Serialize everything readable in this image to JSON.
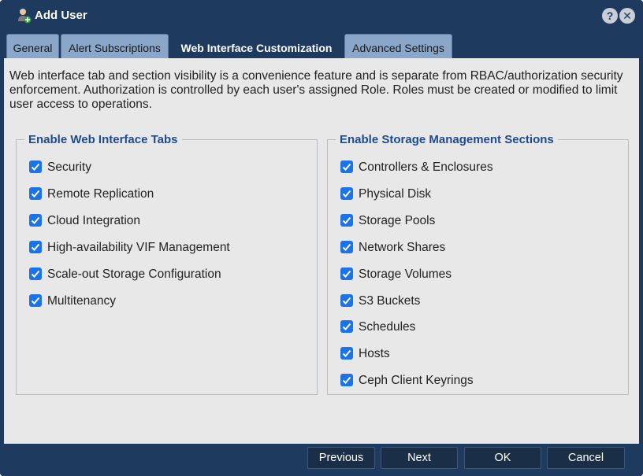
{
  "window": {
    "title": "Add User",
    "title_icon": "add-user-icon",
    "help_glyph": "?",
    "close_glyph": "✕"
  },
  "tabs": [
    {
      "label": "General",
      "active": false
    },
    {
      "label": "Alert Subscriptions",
      "active": false
    },
    {
      "label": "Web Interface Customization",
      "active": true
    },
    {
      "label": "Advanced Settings",
      "active": false
    }
  ],
  "description": "Web interface tab and section visibility is a convenience feature and is separate from RBAC/authorization security enforcement. Authorization is controlled by each user's assigned Role. Roles must be created or modified to limit user access to operations.",
  "web_tabs_group": {
    "title": "Enable Web Interface Tabs",
    "items": [
      {
        "label": "Security",
        "checked": true
      },
      {
        "label": "Remote Replication",
        "checked": true
      },
      {
        "label": "Cloud Integration",
        "checked": true
      },
      {
        "label": "High-availability VIF Management",
        "checked": true
      },
      {
        "label": "Scale-out Storage Configuration",
        "checked": true
      },
      {
        "label": "Multitenancy",
        "checked": true
      }
    ]
  },
  "storage_sections_group": {
    "title": "Enable Storage Management Sections",
    "items": [
      {
        "label": "Controllers & Enclosures",
        "checked": true
      },
      {
        "label": "Physical Disk",
        "checked": true
      },
      {
        "label": "Storage Pools",
        "checked": true
      },
      {
        "label": "Network Shares",
        "checked": true
      },
      {
        "label": "Storage Volumes",
        "checked": true
      },
      {
        "label": "S3 Buckets",
        "checked": true
      },
      {
        "label": "Schedules",
        "checked": true
      },
      {
        "label": "Hosts",
        "checked": true
      },
      {
        "label": "Ceph Client Keyrings",
        "checked": true
      }
    ]
  },
  "footer": {
    "previous_label": "Previous",
    "next_label": "Next",
    "ok_label": "OK",
    "cancel_label": "Cancel"
  },
  "colors": {
    "chrome": "#1f3a5f",
    "tab_inactive": "#8aa6c8",
    "content_bg": "#e8e8e8",
    "group_title": "#1d4b8f",
    "checkbox": "#1a73e8"
  }
}
